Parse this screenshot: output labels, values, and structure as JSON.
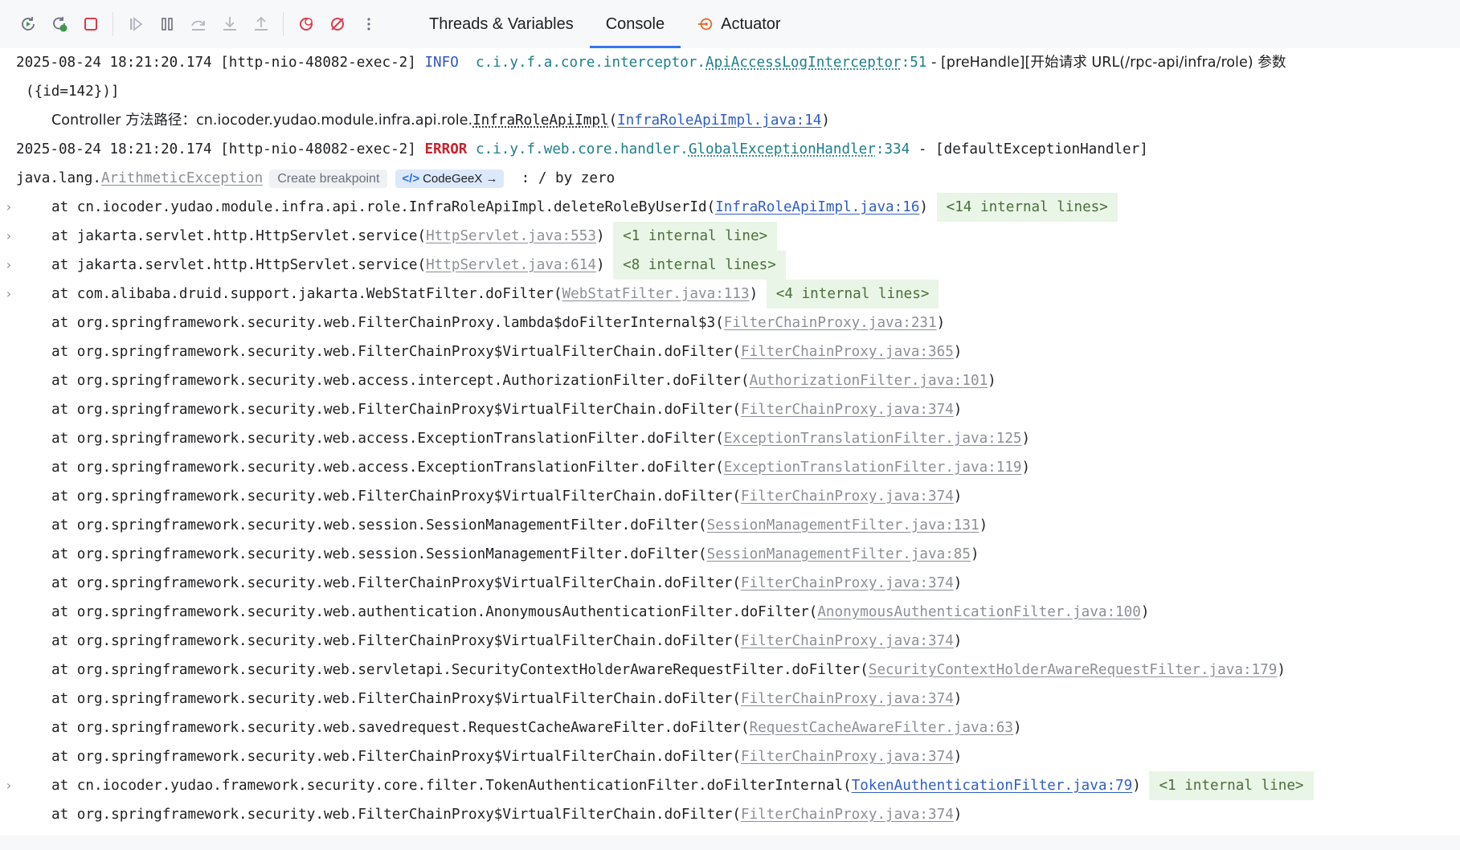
{
  "toolbar": {
    "tabs": [
      {
        "label": "Threads & Variables"
      },
      {
        "label": "Console"
      },
      {
        "label": "Actuator"
      }
    ]
  },
  "colors": {
    "accent": "#3574f0",
    "error": "#c7222d",
    "info": "#2f54c9",
    "link": "#2f5ec4",
    "internal_bg": "#e9f5e6"
  },
  "console": {
    "line1": {
      "timestamp": "2025-08-24 18:21:20.174 [http-nio-48082-exec-2] ",
      "level": "INFO",
      "logger_prefix": "c.i.y.f.a.core.interceptor.",
      "logger_class": "ApiAccessLogInterceptor",
      "logger_line": ":51",
      "message": " - [preHandle][开始请求 URL(/rpc-api/infra/role) 参数",
      "continuation": "({id=142})]"
    },
    "controller_line": {
      "prefix": "Controller 方法路径：cn.iocoder.yudao.module.infra.api.role.",
      "class": "InfraRoleApiImpl",
      "open": "(",
      "link": "InfraRoleApiImpl.java:14",
      "close": ")"
    },
    "line2": {
      "timestamp": "2025-08-24 18:21:20.174 [http-nio-48082-exec-2] ",
      "level": "ERROR",
      "logger_prefix": "c.i.y.f.web.core.handler.",
      "logger_class": "GlobalExceptionHandler",
      "logger_line": ":334",
      "message": " - [defaultExceptionHandler]"
    },
    "exception": {
      "prefix": "java.lang.",
      "class": "ArithmeticException",
      "create_breakpoint": "Create breakpoint",
      "codegeex": "CodeGeeX",
      "message": ": / by zero"
    },
    "frames": [
      {
        "expandable": true,
        "text": "at cn.iocoder.yudao.module.infra.api.role.InfraRoleApiImpl.deleteRoleByUserId(",
        "link": "InfraRoleApiImpl.java:16",
        "link_style": "blue",
        "internal": "<14 internal lines>"
      },
      {
        "expandable": true,
        "text": "at jakarta.servlet.http.HttpServlet.service(",
        "link": "HttpServlet.java:553",
        "link_style": "gray",
        "internal": "<1 internal line>"
      },
      {
        "expandable": true,
        "text": "at jakarta.servlet.http.HttpServlet.service(",
        "link": "HttpServlet.java:614",
        "link_style": "gray",
        "internal": "<8 internal lines>"
      },
      {
        "expandable": true,
        "text": "at com.alibaba.druid.support.jakarta.WebStatFilter.doFilter(",
        "link": "WebStatFilter.java:113",
        "link_style": "gray",
        "internal": "<4 internal lines>"
      },
      {
        "expandable": false,
        "text": "at org.springframework.security.web.FilterChainProxy.lambda$doFilterInternal$3(",
        "link": "FilterChainProxy.java:231",
        "link_style": "gray",
        "internal": ""
      },
      {
        "expandable": false,
        "text": "at org.springframework.security.web.FilterChainProxy$VirtualFilterChain.doFilter(",
        "link": "FilterChainProxy.java:365",
        "link_style": "gray",
        "internal": ""
      },
      {
        "expandable": false,
        "text": "at org.springframework.security.web.access.intercept.AuthorizationFilter.doFilter(",
        "link": "AuthorizationFilter.java:101",
        "link_style": "gray",
        "internal": ""
      },
      {
        "expandable": false,
        "text": "at org.springframework.security.web.FilterChainProxy$VirtualFilterChain.doFilter(",
        "link": "FilterChainProxy.java:374",
        "link_style": "gray",
        "internal": ""
      },
      {
        "expandable": false,
        "text": "at org.springframework.security.web.access.ExceptionTranslationFilter.doFilter(",
        "link": "ExceptionTranslationFilter.java:125",
        "link_style": "gray",
        "internal": ""
      },
      {
        "expandable": false,
        "text": "at org.springframework.security.web.access.ExceptionTranslationFilter.doFilter(",
        "link": "ExceptionTranslationFilter.java:119",
        "link_style": "gray",
        "internal": ""
      },
      {
        "expandable": false,
        "text": "at org.springframework.security.web.FilterChainProxy$VirtualFilterChain.doFilter(",
        "link": "FilterChainProxy.java:374",
        "link_style": "gray",
        "internal": ""
      },
      {
        "expandable": false,
        "text": "at org.springframework.security.web.session.SessionManagementFilter.doFilter(",
        "link": "SessionManagementFilter.java:131",
        "link_style": "gray",
        "internal": ""
      },
      {
        "expandable": false,
        "text": "at org.springframework.security.web.session.SessionManagementFilter.doFilter(",
        "link": "SessionManagementFilter.java:85",
        "link_style": "gray",
        "internal": ""
      },
      {
        "expandable": false,
        "text": "at org.springframework.security.web.FilterChainProxy$VirtualFilterChain.doFilter(",
        "link": "FilterChainProxy.java:374",
        "link_style": "gray",
        "internal": ""
      },
      {
        "expandable": false,
        "text": "at org.springframework.security.web.authentication.AnonymousAuthenticationFilter.doFilter(",
        "link": "AnonymousAuthenticationFilter.java:100",
        "link_style": "gray",
        "internal": ""
      },
      {
        "expandable": false,
        "text": "at org.springframework.security.web.FilterChainProxy$VirtualFilterChain.doFilter(",
        "link": "FilterChainProxy.java:374",
        "link_style": "gray",
        "internal": ""
      },
      {
        "expandable": false,
        "text": "at org.springframework.security.web.servletapi.SecurityContextHolderAwareRequestFilter.doFilter(",
        "link": "SecurityContextHolderAwareRequestFilter.java:179",
        "link_style": "gray",
        "internal": ""
      },
      {
        "expandable": false,
        "text": "at org.springframework.security.web.FilterChainProxy$VirtualFilterChain.doFilter(",
        "link": "FilterChainProxy.java:374",
        "link_style": "gray",
        "internal": ""
      },
      {
        "expandable": false,
        "text": "at org.springframework.security.web.savedrequest.RequestCacheAwareFilter.doFilter(",
        "link": "RequestCacheAwareFilter.java:63",
        "link_style": "gray",
        "internal": ""
      },
      {
        "expandable": false,
        "text": "at org.springframework.security.web.FilterChainProxy$VirtualFilterChain.doFilter(",
        "link": "FilterChainProxy.java:374",
        "link_style": "gray",
        "internal": ""
      },
      {
        "expandable": true,
        "text": "at cn.iocoder.yudao.framework.security.core.filter.TokenAuthenticationFilter.doFilterInternal(",
        "link": "TokenAuthenticationFilter.java:79",
        "link_style": "blue",
        "internal": "<1 internal line>"
      },
      {
        "expandable": false,
        "text": "at org.springframework.security.web.FilterChainProxy$VirtualFilterChain.doFilter(",
        "link": "FilterChainProxy.java:374",
        "link_style": "gray",
        "internal": ""
      }
    ]
  }
}
